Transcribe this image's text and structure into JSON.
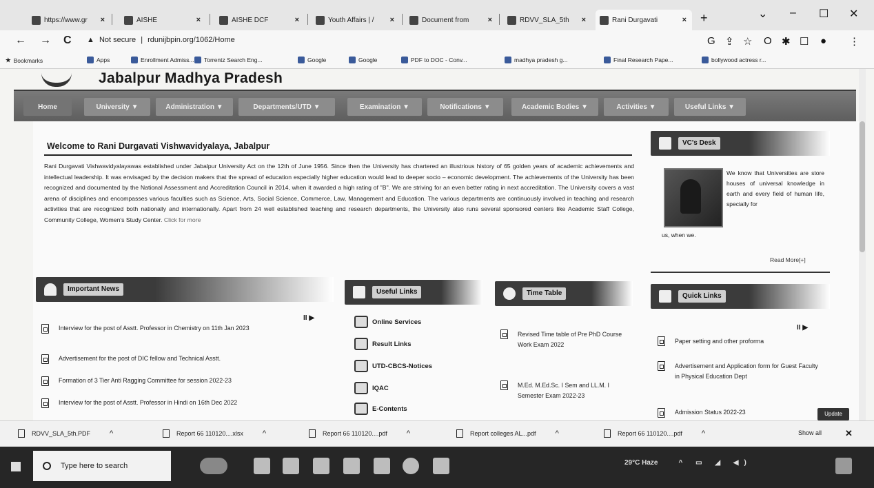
{
  "browser": {
    "tabs": [
      {
        "label": "https://www.gr"
      },
      {
        "label": "AISHE"
      },
      {
        "label": "AISHE DCF"
      },
      {
        "label": "Youth Affairs | /"
      },
      {
        "label": "Document from"
      },
      {
        "label": "RDVV_SLA_5th"
      },
      {
        "label": "Rani Durgavati"
      }
    ],
    "new_tab": "+",
    "window_controls": {
      "dropdown": "⌄",
      "minimize": "–",
      "maximize": "☐",
      "close": "✕"
    },
    "nav": {
      "back": "←",
      "forward": "→",
      "reload": "C"
    },
    "address": {
      "security": "Not secure",
      "url": "rdunijbpin.org/1062/Home"
    },
    "bookmarks": [
      {
        "label": "Bookmarks"
      },
      {
        "label": "Apps"
      },
      {
        "label": "Enrollment Admiss..."
      },
      {
        "label": "Torrentz Search Eng..."
      },
      {
        "label": "Google"
      },
      {
        "label": "Google"
      },
      {
        "label": "PDF to DOC - Conv..."
      },
      {
        "label": "madhya pradesh g..."
      },
      {
        "label": "Final Research Pape..."
      },
      {
        "label": "bollywood actress r..."
      }
    ]
  },
  "site": {
    "title": "Jabalpur Madhya Pradesh",
    "menu": [
      {
        "label": "Home"
      },
      {
        "label": "University ▼"
      },
      {
        "label": "Administration ▼"
      },
      {
        "label": "Departments/UTD ▼"
      },
      {
        "label": "Examination ▼"
      },
      {
        "label": "Notifications ▼"
      },
      {
        "label": "Academic Bodies ▼"
      },
      {
        "label": "Activities ▼"
      },
      {
        "label": "Useful Links ▼"
      }
    ]
  },
  "welcome": {
    "title": "Welcome to Rani Durgavati Vishwavidyalaya, Jabalpur",
    "body": "Rani Durgavati Vishwavidyalayawas established under Jabalpur University Act on the 12th of June 1956. Since then the University has chartered an illustrious history of 65 golden years of academic achievements and intellectual leadership. It was envisaged by the decision makers that the spread of education especially higher education would lead to deeper socio – economic development. The achievements of the University has been recognized and documented by the National Assessment and Accreditation Council in 2014, when it awarded a high rating of \"B\". We are striving for an even better rating in next accreditation. The University covers a vast arena of disciplines and encompasses various faculties such as Science, Arts, Social Science, Commerce, Law, Management and Education. The various departments are continuously involved in teaching and research activities that are recognized both nationally and internationally. Apart from 24 well established teaching and research departments, the University also runs several sponsored centers like Academic Staff College, Community College, Women's Study Center.",
    "more_link": "Click for more"
  },
  "vc_desk": {
    "heading": "VC's Desk",
    "text": "We know that Universities are store houses of universal knowledge in earth and every field of human life, specially for",
    "text_end": "us, when we.",
    "read_more": "Read More[+]"
  },
  "important_news": {
    "heading": "Important News",
    "items": [
      "Interview for the post of Asstt. Professor in Chemistry on 11th Jan 2023",
      "Advertisement for the post of DIC fellow and Technical Asstt.",
      "Formation of 3 Tier Anti Ragging Committee for session 2022-23",
      "Interview for the post of Asstt. Professor in Hindi on 16th Dec 2022"
    ]
  },
  "useful_links": {
    "heading": "Useful Links",
    "items": [
      "Online Services",
      "Result Links",
      "UTD-CBCS-Notices",
      "IQAC",
      "E-Contents"
    ]
  },
  "time_table": {
    "heading": "Time Table",
    "items": [
      "Revised Time table of Pre PhD Course Work Exam 2022",
      "M.Ed. M.Ed.Sc. I Sem and LL.M. I Semester Exam 2022-23"
    ]
  },
  "quick_links": {
    "heading": "Quick Links",
    "items": [
      "Paper setting and other proforma",
      "Advertisement and Application form for Guest Faculty in Physical Education Dept",
      "Admission Status 2022-23"
    ],
    "update_btn": "Update"
  },
  "ticker_controls": "II ▶",
  "downloads": {
    "items": [
      {
        "name": "RDVV_SLA_5th.PDF"
      },
      {
        "name": "Report 66 110120....xlsx"
      },
      {
        "name": "Report 66 110120....pdf"
      },
      {
        "name": "Report colleges AL...pdf"
      },
      {
        "name": "Report 66 110120....pdf"
      }
    ],
    "show_all": "Show all",
    "close": "✕"
  },
  "taskbar": {
    "search_placeholder": "Type here to search",
    "weather": "29°C Haze"
  }
}
